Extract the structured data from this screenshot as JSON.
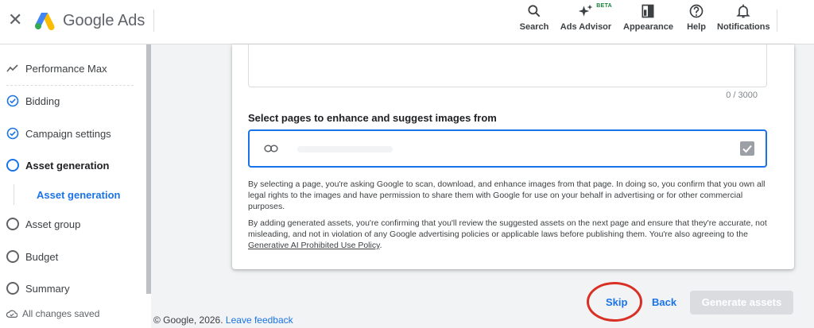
{
  "header": {
    "brand": "Google Ads",
    "tools": [
      {
        "label": "Search",
        "icon": "search-icon"
      },
      {
        "label": "Ads Advisor",
        "icon": "sparkle-icon",
        "badge": "BETA"
      },
      {
        "label": "Appearance",
        "icon": "appearance-icon"
      },
      {
        "label": "Help",
        "icon": "help-icon"
      },
      {
        "label": "Notifications",
        "icon": "bell-icon"
      }
    ]
  },
  "sidebar": {
    "items": [
      {
        "label": "Performance Max",
        "state": "header"
      },
      {
        "label": "Bidding",
        "state": "done"
      },
      {
        "label": "Campaign settings",
        "state": "done"
      },
      {
        "label": "Asset generation",
        "state": "active"
      },
      {
        "label": "Asset generation",
        "state": "sub-active"
      },
      {
        "label": "Asset group",
        "state": "todo"
      },
      {
        "label": "Budget",
        "state": "todo"
      },
      {
        "label": "Summary",
        "state": "todo"
      }
    ],
    "saved_status": "All changes saved"
  },
  "card": {
    "char_counter": "0 / 3000",
    "section_title": "Select pages to enhance and suggest images from",
    "disclaimer_1": "By selecting a page, you're asking Google to scan, download, and enhance images from that page. In doing so, you confirm that you own all legal rights to the images and have permission to share them with Google for use on your behalf in advertising or for other commercial purposes.",
    "disclaimer_2_prefix": "By adding generated assets, you're confirming that you'll review the suggested assets on the next page and ensure that they're accurate, not misleading, and not in violation of any Google advertising policies or applicable laws before publishing them. You're also agreeing to the ",
    "disclaimer_2_link": "Generative AI Prohibited Use Policy",
    "disclaimer_2_suffix": "."
  },
  "actions": {
    "skip": "Skip",
    "back": "Back",
    "generate": "Generate assets"
  },
  "footer": {
    "copyright": "© Google, 2026.",
    "feedback": "Leave feedback"
  },
  "colors": {
    "accent": "#1a73e8",
    "annotation": "#d93025",
    "disabled": "#dadce0"
  }
}
